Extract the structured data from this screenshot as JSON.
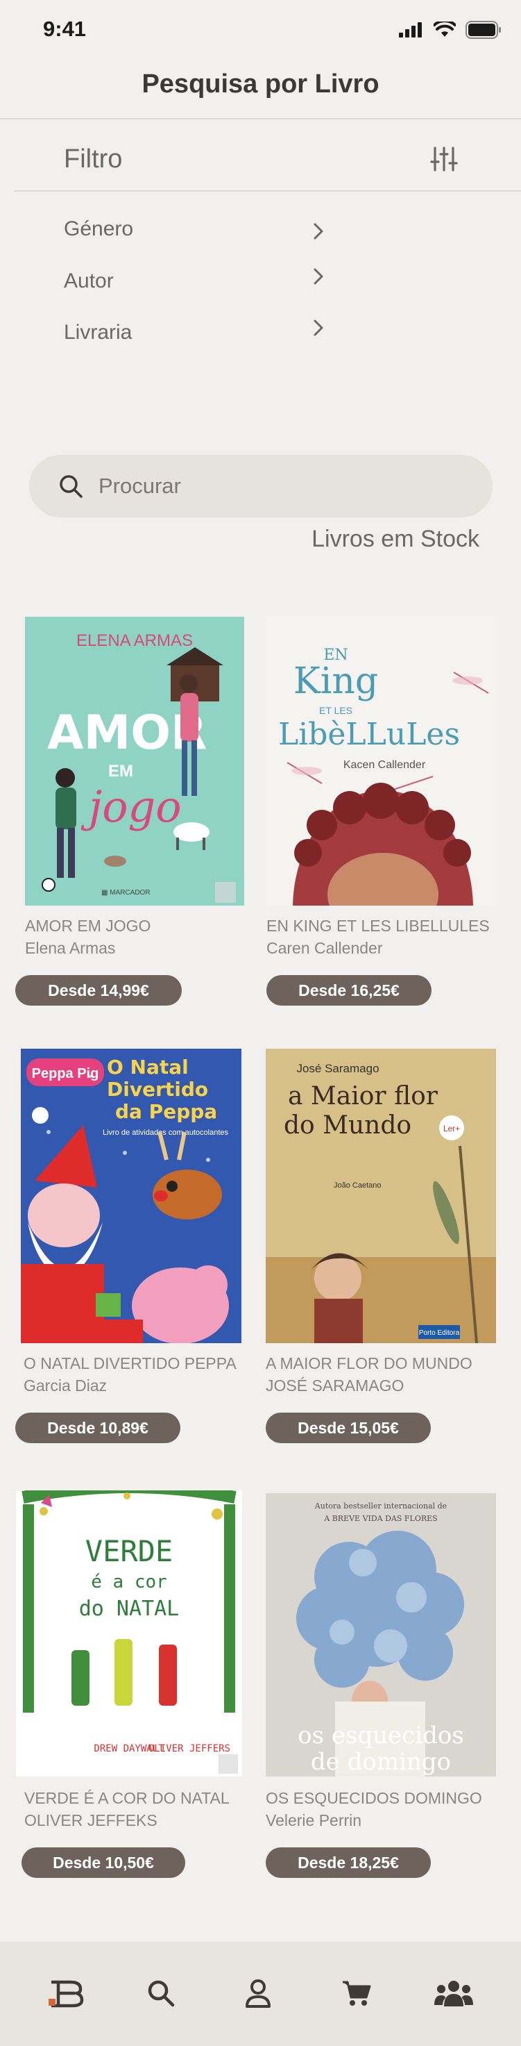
{
  "status_bar": {
    "time": "9:41"
  },
  "header": {
    "title": "Pesquisa por Livro"
  },
  "filter": {
    "label": "Filtro",
    "options": [
      {
        "label": "Género"
      },
      {
        "label": "Autor"
      },
      {
        "label": "Livraria"
      }
    ]
  },
  "search": {
    "placeholder": "Procurar"
  },
  "stock_label": "Livros em Stock",
  "books": [
    {
      "title": "AMOR EM JOGO",
      "author": "Elena Armas",
      "price": "Desde 14,99€",
      "cover_text": [
        "ELENA ARMAS",
        "AMOR",
        "EM",
        "jogo"
      ],
      "cover_color": "#8fd3c4"
    },
    {
      "title": "EN KING ET LES LIBELLULES",
      "author": "Caren Callender",
      "price": "Desde 16,25€",
      "cover_text": [
        "EN",
        "King",
        "ET LES",
        "LibèLLuLes",
        "Kacen Callender"
      ],
      "cover_color": "#f4f3ef"
    },
    {
      "title": "O NATAL DIVERTIDO PEPPA",
      "author": "Garcia Diaz",
      "price": "Desde 10,89€",
      "cover_text": [
        "Peppa Pig",
        "O Natal",
        "Divertido",
        "da Peppa",
        "Livro de atividades com autocolantes"
      ],
      "cover_color": "#3258b0"
    },
    {
      "title": "A MAIOR FLOR DO MUNDO",
      "author": "JOSÉ SARAMAGO",
      "price": "Desde 15,05€",
      "cover_text": [
        "José Saramago",
        "a Maior flor",
        "do Mundo",
        "João Caetano",
        "Porto Editora"
      ],
      "cover_color": "#d6c088"
    },
    {
      "title": "VERDE É A COR DO NATAL",
      "author": "OLIVER JEFFEKS",
      "price": "Desde 10,50€",
      "cover_text": [
        "VERDE",
        "é a cor",
        "do NATAL",
        "DREW DAYWALT",
        "OLIVER JEFFERS"
      ],
      "cover_color": "#ffffff"
    },
    {
      "title": "OS ESQUECIDOS DOMINGO",
      "author": "Velerie Perrin",
      "price": "Desde 18,25€",
      "cover_text": [
        "Autora bestseller internacional de",
        "A BREVE VIDA DAS FLORES",
        "os esquecidos",
        "de domingo"
      ],
      "cover_color": "#d9d5cf"
    }
  ],
  "nav": [
    {
      "icon": "home-icon"
    },
    {
      "icon": "search-icon"
    },
    {
      "icon": "user-icon"
    },
    {
      "icon": "cart-icon"
    },
    {
      "icon": "community-icon"
    }
  ]
}
